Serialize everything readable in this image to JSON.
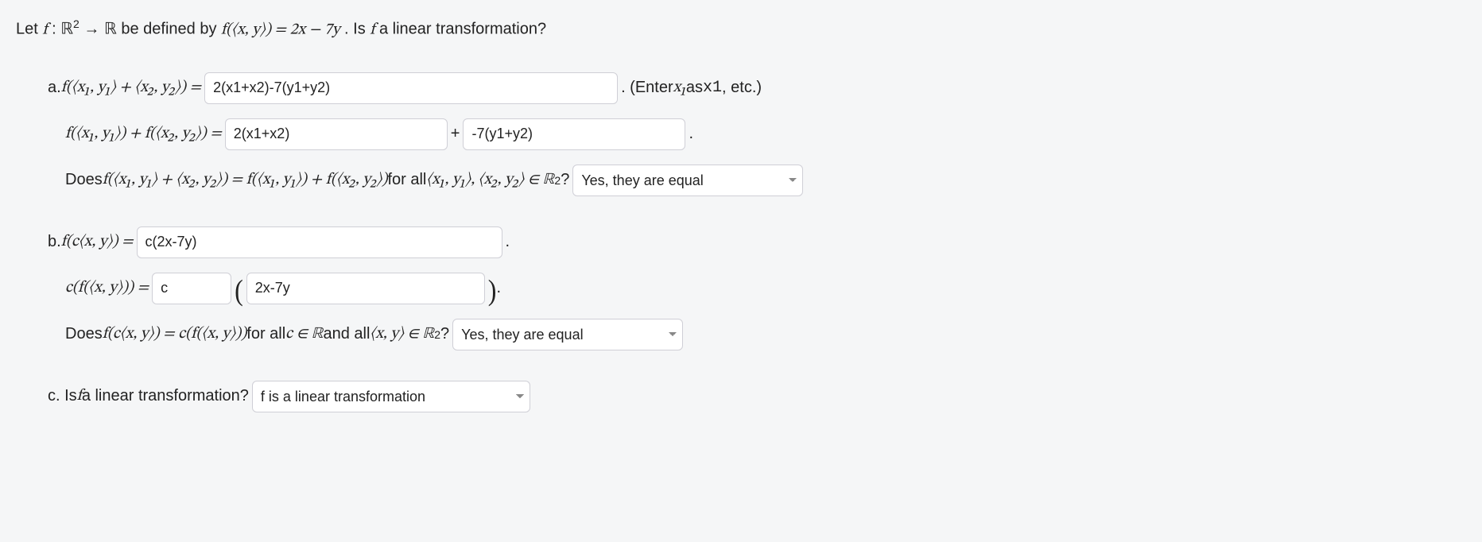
{
  "prompt": {
    "pre": "Let ",
    "f": "f",
    "colon": " : ",
    "R2": "ℝ",
    "sup2": "2",
    "arrow": " → ",
    "R": "ℝ",
    "be": " be defined by ",
    "fxy": "f(⟨x, y⟩) = 2x − 7y",
    "post": ". Is ",
    "f2": "f",
    "trail": " a linear transformation?"
  },
  "a": {
    "label": "a. ",
    "lhs1": "f(⟨x₁, y₁⟩ + ⟨x₂, y₂⟩) = ",
    "input1": "2(x1+x2)-7(y1+y2)",
    "after1a": ". (Enter ",
    "after1b": "x₁",
    "after1c": " as ",
    "after1d": "x1",
    "after1e": ", etc.)",
    "lhs2": "f(⟨x₁, y₁⟩) + f(⟨x₂, y₂⟩) = ",
    "input2a": "2(x1+x2)",
    "plus": " + ",
    "input2b": "-7(y1+y2)",
    "period": ".",
    "q": "Does ",
    "qmath": "f(⟨x₁, y₁⟩ + ⟨x₂, y₂⟩) = f(⟨x₁, y₁⟩) + f(⟨x₂, y₂⟩)",
    "qfor": " for all ",
    "qset": "⟨x₁, y₁⟩, ⟨x₂, y₂⟩ ∈ ℝ",
    "qsup": "2",
    "qq": "? ",
    "select": "Yes, they are equal"
  },
  "b": {
    "label": "b. ",
    "lhs1": "f(c⟨x, y⟩) = ",
    "input1": "c(2x-7y)",
    "period1": ".",
    "lhs2": "c(f(⟨x, y⟩)) = ",
    "input2a": "c",
    "input2b": "2x-7y",
    "period2": ".",
    "q": "Does ",
    "qmath": "f(c⟨x, y⟩) = c(f(⟨x, y⟩))",
    "qfor": " for all ",
    "qc": "c ∈ ℝ",
    "qand": " and all ",
    "qxy": "⟨x, y⟩ ∈ ℝ",
    "qsup": "2",
    "qq": "? ",
    "select": "Yes, they are equal"
  },
  "c": {
    "label": "c. Is ",
    "f": "f",
    "rest": " a linear transformation? ",
    "select": "f is a linear transformation"
  }
}
